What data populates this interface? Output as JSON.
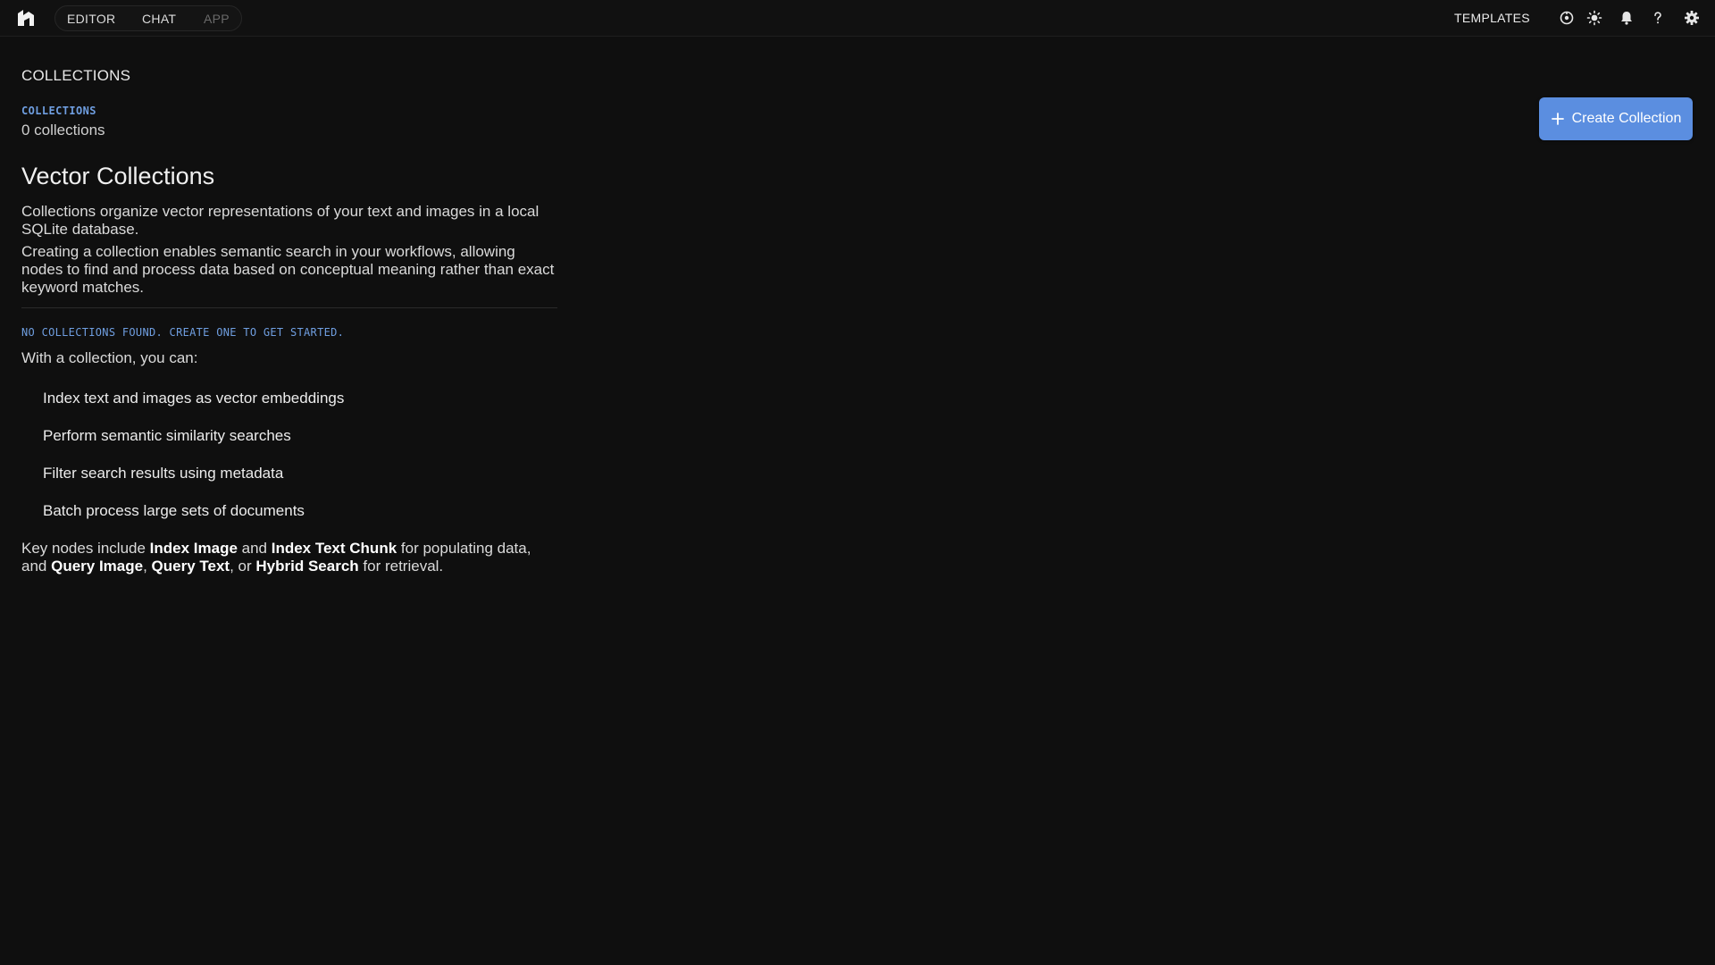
{
  "topbar": {
    "modes": [
      {
        "label": "EDITOR",
        "enabled": true
      },
      {
        "label": "CHAT",
        "enabled": true
      },
      {
        "label": "APP",
        "enabled": false
      }
    ],
    "templates_label": "TEMPLATES",
    "icons": [
      "logo-icon",
      "workflow-status-icon",
      "theme-sun-icon",
      "bell-icon",
      "help-icon",
      "gear-icon"
    ]
  },
  "page": {
    "title": "COLLECTIONS",
    "section_label": "COLLECTIONS",
    "collection_count": "0 collections",
    "create_button_label": "Create Collection",
    "heading": "Vector Collections",
    "description_1": "Collections organize vector representations of your text and images in a local SQLite database.",
    "description_2": "Creating a collection enables semantic search in your workflows, allowing nodes to find and process data based on conceptual meaning rather than exact keyword matches.",
    "empty_notice": "NO COLLECTIONS FOUND. CREATE ONE TO GET STARTED.",
    "capabilities_intro": "With a collection, you can:",
    "capabilities": [
      "Index text and images as vector embeddings",
      "Perform semantic similarity searches",
      "Filter search results using metadata",
      "Batch process large sets of documents"
    ],
    "key_nodes": {
      "t1": "Key nodes include ",
      "n1": "Index Image",
      "t2": " and ",
      "n2": "Index Text Chunk",
      "t3": " for populating data, and ",
      "n3": "Query Image",
      "t4": ", ",
      "n4": "Query Text",
      "t5": ", or ",
      "n5": "Hybrid Search",
      "t6": " for retrieval."
    }
  },
  "colors": {
    "background": "#0f0f0f",
    "accent": "#5b8ee0",
    "label_blue": "#6f9ee0"
  }
}
